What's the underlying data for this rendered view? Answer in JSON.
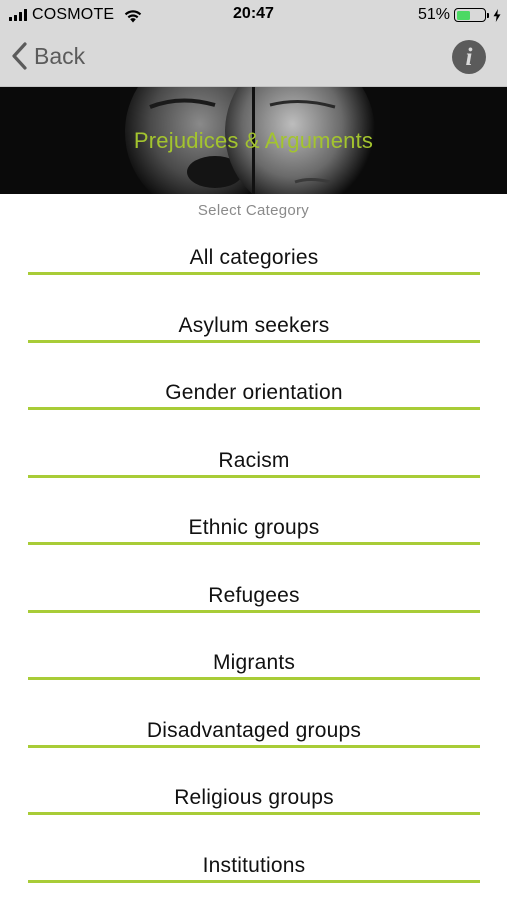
{
  "status_bar": {
    "carrier": "COSMOTE",
    "time": "20:47",
    "battery_percent_label": "51%",
    "battery_level": 0.51,
    "icons": [
      "signal-bars-icon",
      "wifi-icon",
      "battery-icon",
      "charging-bolt-icon"
    ]
  },
  "nav": {
    "back_label": "Back",
    "info_glyph": "i",
    "icons": [
      "chevron-left-icon",
      "info-icon"
    ]
  },
  "banner": {
    "title": "Prejudices & Arguments"
  },
  "list": {
    "header": "Select Category",
    "categories": [
      {
        "label": "All categories"
      },
      {
        "label": "Asylum seekers"
      },
      {
        "label": "Gender orientation"
      },
      {
        "label": "Racism"
      },
      {
        "label": "Ethnic groups"
      },
      {
        "label": "Refugees"
      },
      {
        "label": "Migrants"
      },
      {
        "label": "Disadvantaged groups"
      },
      {
        "label": "Religious groups"
      },
      {
        "label": "Institutions"
      }
    ]
  },
  "colors": {
    "accent": "#a8cc37",
    "banner_title": "#a3c42e",
    "bar_background": "#d9d9d9",
    "nav_tint": "#5b5b5b",
    "battery_fill": "#4cd964"
  }
}
